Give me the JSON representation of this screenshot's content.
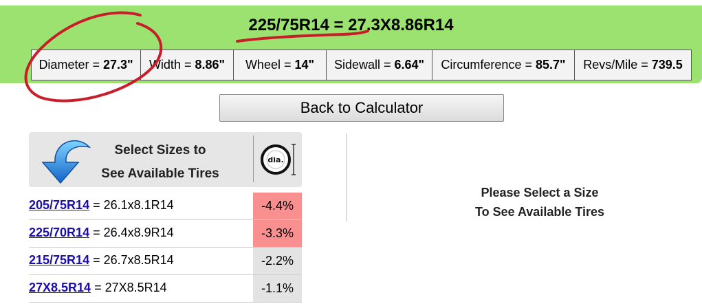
{
  "header": {
    "title": "225/75R14 = 27.3X8.86R14",
    "specs": [
      {
        "label": "Diameter =",
        "value": "27.3\""
      },
      {
        "label": "Width =",
        "value": "8.86\""
      },
      {
        "label": "Wheel =",
        "value": "14\""
      },
      {
        "label": "Sidewall =",
        "value": "6.64\""
      },
      {
        "label": "Circumference =",
        "value": "85.7\""
      },
      {
        "label": "Revs/Mile =",
        "value": "739.5"
      }
    ]
  },
  "back_button": "Back to Calculator",
  "panel": {
    "line1": "Select Sizes to",
    "line2": "See Available Tires",
    "icon_text": "dia."
  },
  "rows": [
    {
      "size": "205/75R14",
      "equiv": "= 26.1x8.1R14",
      "diff": "-4.4%",
      "color": "#fa8f8f"
    },
    {
      "size": "225/70R14",
      "equiv": "= 26.4x8.9R14",
      "diff": "-3.3%",
      "color": "#fa8f8f"
    },
    {
      "size": "215/75R14",
      "equiv": "= 26.7x8.5R14",
      "diff": "-2.2%",
      "color": "#e3e3e3"
    },
    {
      "size": "27X8.5R14",
      "equiv": "= 27X8.5R14",
      "diff": "-1.1%",
      "color": "#e3e3e3"
    }
  ],
  "message": {
    "line1": "Please Select a Size",
    "line2": "To See Available Tires"
  },
  "colors": {
    "header_bg": "#9be270",
    "link": "#1a0dab",
    "annotation": "#c81e2a"
  }
}
